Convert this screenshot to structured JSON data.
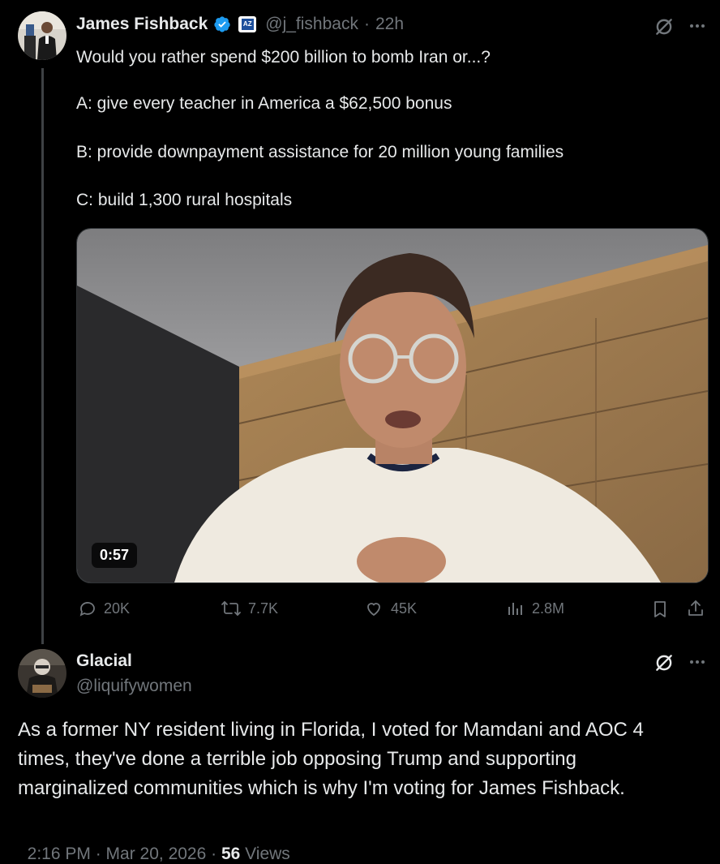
{
  "original_tweet": {
    "author_name": "James Fishback",
    "handle": "@j_fishback",
    "time": "22h",
    "text_lines": [
      "Would you rather spend $200 billion to bomb Iran or...?",
      "A: give every teacher in America a $62,500 bonus",
      "B: provide downpayment assistance for 20 million young families",
      "C: build 1,300 rural hospitals"
    ],
    "video_duration": "0:57",
    "stats": {
      "replies": "20K",
      "reposts": "7.7K",
      "likes": "45K",
      "views": "2.8M"
    },
    "badge_text": "AZ"
  },
  "reply_tweet": {
    "author_name": "Glacial",
    "handle": "@liquifywomen",
    "text_lines": [
      "As a former NY resident living in Florida, I voted for Mamdani and AOC 4",
      "times, they've done a terrible job opposing Trump and supporting",
      "marginalized communities which is why I'm voting for James Fishback."
    ],
    "timestamp": "2:16 PM · Mar 20, 2026 · ",
    "views_count": "56",
    "views_label": " Views"
  },
  "colors": {
    "background": "#000000",
    "text": "#e7e9ea",
    "muted": "#71767b",
    "verified": "#1d9bf0"
  },
  "icons": [
    "grok-icon",
    "more-icon",
    "verified-badge-icon",
    "affiliate-badge-icon",
    "reply-icon",
    "repost-icon",
    "like-icon",
    "views-icon",
    "bookmark-icon",
    "share-icon"
  ]
}
